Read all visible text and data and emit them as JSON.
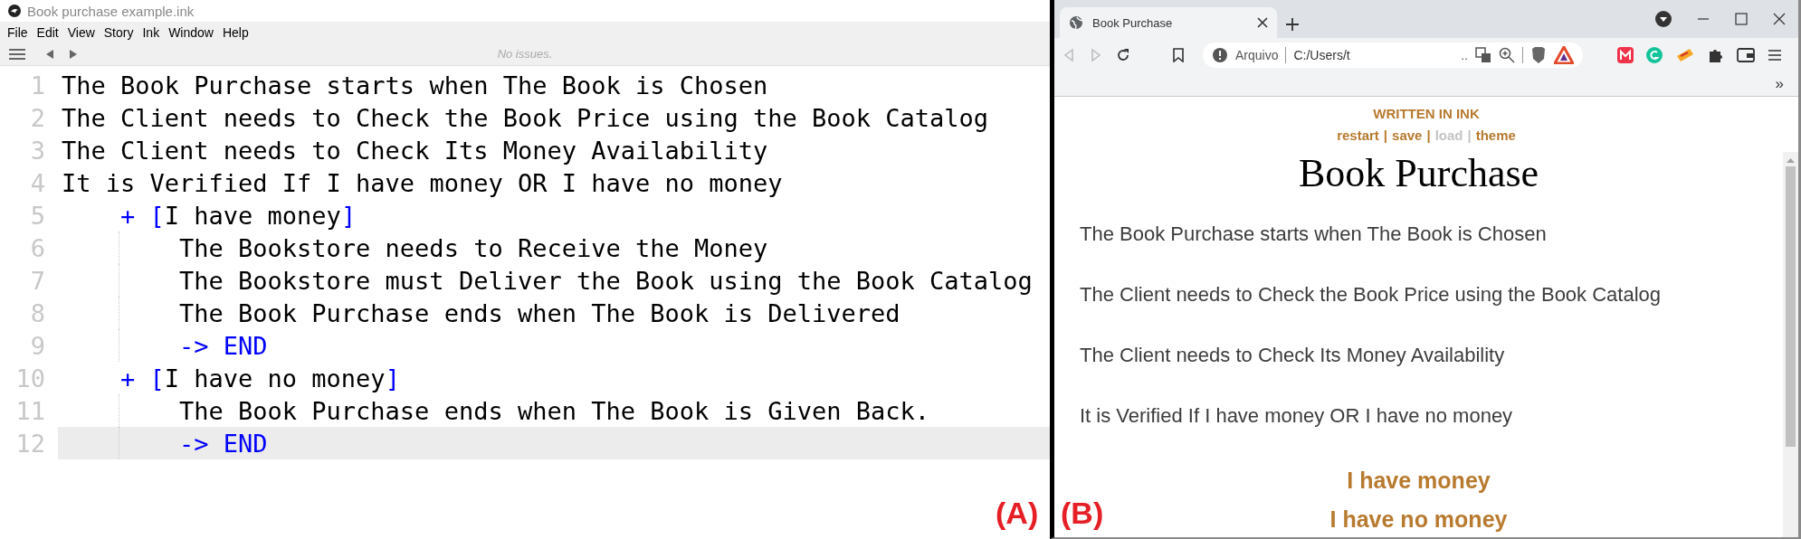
{
  "editor": {
    "title": "Book purchase example.ink",
    "menu": [
      {
        "label": "File"
      },
      {
        "label": "Edit"
      },
      {
        "label": "View"
      },
      {
        "label": "Story"
      },
      {
        "label": "Ink"
      },
      {
        "label": "Window"
      },
      {
        "label": "Help"
      }
    ],
    "status": "No issues.",
    "lines": [
      {
        "number": "1",
        "kind": "text",
        "text": "The Book Purchase starts when The Book is Chosen",
        "active": false
      },
      {
        "number": "2",
        "kind": "text",
        "text": "The Client needs to Check the Book Price using the Book Catalog",
        "active": false
      },
      {
        "number": "3",
        "kind": "text",
        "text": "The Client needs to Check Its Money Availability",
        "active": false
      },
      {
        "number": "4",
        "kind": "text",
        "text": "It is Verified If I have money OR I have no money",
        "active": false
      },
      {
        "number": "5",
        "kind": "choice",
        "marker": "+",
        "open": "[",
        "label": "I have money",
        "close": "]",
        "active": false,
        "children": [
          {
            "number": "6",
            "kind": "text",
            "text": "The Bookstore needs to Receive the Money",
            "active": false
          },
          {
            "number": "7",
            "kind": "text",
            "text": "The Bookstore must Deliver the Book using the Book Catalog",
            "active": false
          },
          {
            "number": "8",
            "kind": "text",
            "text": "The Book Purchase ends when The Book is Delivered",
            "active": false
          },
          {
            "number": "9",
            "kind": "divert",
            "arrow": "->",
            "target": "END",
            "active": false
          }
        ]
      },
      {
        "number": "10",
        "kind": "choice",
        "marker": "+",
        "open": "[",
        "label": "I have no money",
        "close": "]",
        "active": false,
        "children": [
          {
            "number": "11",
            "kind": "text",
            "text": "The Book Purchase ends when The Book is Given Back.",
            "active": false
          },
          {
            "number": "12",
            "kind": "divert",
            "arrow": "->",
            "target": "END",
            "active": true
          }
        ]
      }
    ]
  },
  "browser": {
    "tab": {
      "title": "Book Purchase",
      "selected": true
    },
    "address": {
      "scheme": "Arquivo",
      "path": "C:/Users/t",
      "ellipsis": ".."
    },
    "bookmarks_overflow": "»",
    "page": {
      "credit": "WRITTEN IN INK",
      "controls": [
        {
          "label": "restart",
          "disabled": false,
          "separator": "|"
        },
        {
          "label": "save",
          "disabled": false,
          "separator": "|"
        },
        {
          "label": "load",
          "disabled": true,
          "separator": "|"
        },
        {
          "label": "theme",
          "disabled": false
        }
      ],
      "title": "Book Purchase",
      "paragraphs": [
        "The Book Purchase starts when The Book is Chosen",
        "The Client needs to Check the Book Price using the Book Catalog",
        "The Client needs to Check Its Money Availability",
        "It is Verified If I have money OR I have no money"
      ],
      "choices": [
        {
          "label": "I have money"
        },
        {
          "label": "I have no money"
        }
      ]
    }
  },
  "annotations": [
    {
      "text": "(A)"
    },
    {
      "text": "(B)"
    }
  ]
}
